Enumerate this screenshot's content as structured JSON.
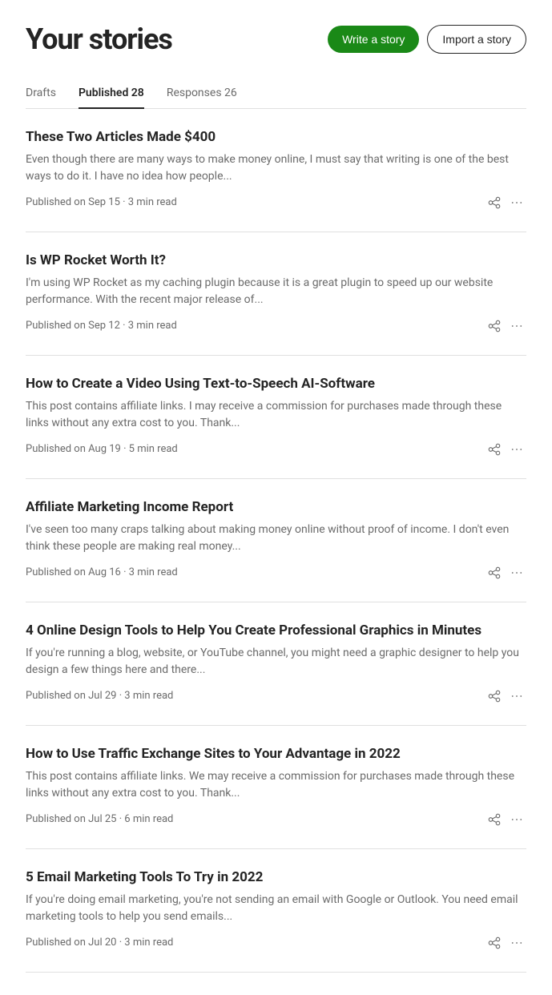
{
  "header": {
    "title": "Your stories",
    "write_button": "Write a story",
    "import_button": "Import a story"
  },
  "tabs": [
    {
      "id": "drafts",
      "label": "Drafts",
      "active": false
    },
    {
      "id": "published",
      "label": "Published 28",
      "active": true
    },
    {
      "id": "responses",
      "label": "Responses 26",
      "active": false
    }
  ],
  "stories": [
    {
      "id": 1,
      "title": "These Two Articles Made $400",
      "excerpt": "Even though there are many ways to make money online, I must say that writing is one of the best ways to do it. I have no idea how people...",
      "meta": "Published on Sep 15 · 3 min read"
    },
    {
      "id": 2,
      "title": "Is WP Rocket Worth It?",
      "excerpt": "I'm using WP Rocket as my caching plugin because it is a great plugin to speed up our website performance. With the recent major release of...",
      "meta": "Published on Sep 12 · 3 min read"
    },
    {
      "id": 3,
      "title": "How to Create a Video Using Text-to-Speech AI-Software",
      "excerpt": "This post contains affiliate links. I may receive a commission for purchases made through these links without any extra cost to you. Thank...",
      "meta": "Published on Aug 19 · 5 min read"
    },
    {
      "id": 4,
      "title": "Affiliate Marketing Income Report",
      "excerpt": "I've seen too many craps talking about making money online without proof of income. I don't even think these people are making real money...",
      "meta": "Published on Aug 16 · 3 min read"
    },
    {
      "id": 5,
      "title": "4 Online Design Tools to Help You Create Professional Graphics in Minutes",
      "excerpt": "If you're running a blog, website, or YouTube channel, you might need a graphic designer to help you design a few things here and there...",
      "meta": "Published on Jul 29 · 3 min read"
    },
    {
      "id": 6,
      "title": "How to Use Traffic Exchange Sites to Your Advantage in 2022",
      "excerpt": "This post contains affiliate links. We may receive a commission for purchases made through these links without any extra cost to you. Thank...",
      "meta": "Published on Jul 25 · 6 min read"
    },
    {
      "id": 7,
      "title": "5 Email Marketing Tools To Try in 2022",
      "excerpt": "If you're doing email marketing, you're not sending an email with Google or Outlook. You need email marketing tools to help you send emails...",
      "meta": "Published on Jul 20 · 3 min read"
    }
  ],
  "icons": {
    "share": "share-icon",
    "more": "more-icon"
  },
  "colors": {
    "accent_green": "#1a8917",
    "border": "#e0e0e0",
    "text_primary": "#242424",
    "text_secondary": "#6b6b6b"
  }
}
